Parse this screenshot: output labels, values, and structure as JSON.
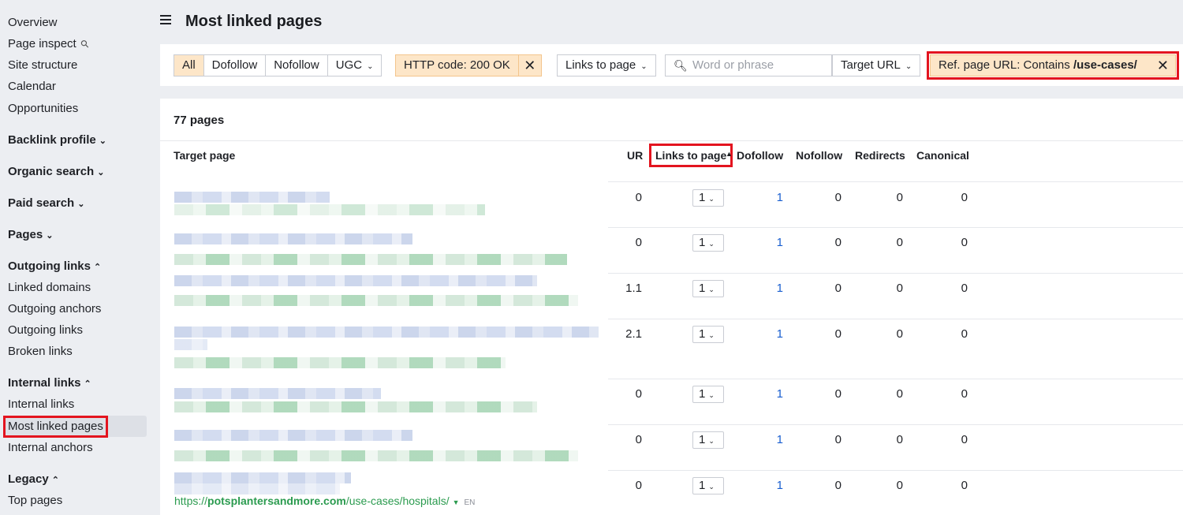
{
  "sidebar": {
    "overview": "Overview",
    "page_inspect": "Page inspect",
    "site_structure": "Site structure",
    "calendar": "Calendar",
    "opportunities": "Opportunities",
    "backlink_profile": "Backlink profile",
    "organic_search": "Organic search",
    "paid_search": "Paid search",
    "pages": "Pages",
    "outgoing_links": "Outgoing links",
    "linked_domains": "Linked domains",
    "outgoing_anchors": "Outgoing anchors",
    "outgoing_links_item": "Outgoing links",
    "broken_links": "Broken links",
    "internal_links": "Internal links",
    "internal_links_item": "Internal links",
    "most_linked_pages": "Most linked pages",
    "internal_anchors": "Internal anchors",
    "legacy": "Legacy",
    "top_pages": "Top pages"
  },
  "header": {
    "title": "Most linked pages"
  },
  "filters": {
    "all": "All",
    "dofollow": "Dofollow",
    "nofollow": "Nofollow",
    "ugc": "UGC",
    "http_code": "HTTP code: 200 OK",
    "links_to_page": "Links to page",
    "search_placeholder": "Word or phrase",
    "target_url": "Target URL",
    "ref_prefix": "Ref. page URL: Contains ",
    "ref_value": "/use-cases/"
  },
  "table": {
    "count": "77 pages",
    "headers": {
      "target_page": "Target page",
      "ur": "UR",
      "links_to_page": "Links to page",
      "dofollow": "Dofollow",
      "nofollow": "Nofollow",
      "redirects": "Redirects",
      "canonical": "Canonical"
    },
    "rows": [
      {
        "ur": "0",
        "links": "1",
        "dofollow": "1",
        "nofollow": "0",
        "redirects": "0",
        "canonical": "0"
      },
      {
        "ur": "0",
        "links": "1",
        "dofollow": "1",
        "nofollow": "0",
        "redirects": "0",
        "canonical": "0"
      },
      {
        "ur": "1.1",
        "links": "1",
        "dofollow": "1",
        "nofollow": "0",
        "redirects": "0",
        "canonical": "0"
      },
      {
        "ur": "2.1",
        "links": "1",
        "dofollow": "1",
        "nofollow": "0",
        "redirects": "0",
        "canonical": "0"
      },
      {
        "ur": "0",
        "links": "1",
        "dofollow": "1",
        "nofollow": "0",
        "redirects": "0",
        "canonical": "0"
      },
      {
        "ur": "0",
        "links": "1",
        "dofollow": "1",
        "nofollow": "0",
        "redirects": "0",
        "canonical": "0"
      },
      {
        "ur": "0",
        "links": "1",
        "dofollow": "1",
        "nofollow": "0",
        "redirects": "0",
        "canonical": "0"
      }
    ],
    "last_url": {
      "prefix": "https://",
      "domain": "potsplantersandmore.com",
      "path": "/use-cases/hospitals/",
      "lang": "EN"
    }
  },
  "colors": {
    "highlight": "#e3141f",
    "active_filter": "#fde6c8",
    "link": "#1a5fd0",
    "url_green": "#2b9b4f"
  }
}
